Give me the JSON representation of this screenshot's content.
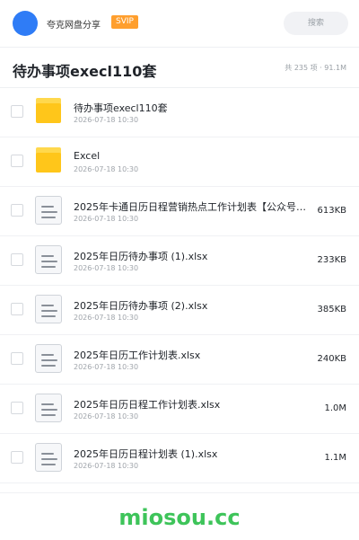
{
  "header": {
    "share_name": "夸克网盘分享",
    "badge": "SVIP",
    "search_label": "搜索"
  },
  "folder": {
    "title": "待办事项execl110套",
    "meta": "共 235 项 · 91.1M"
  },
  "files": [
    {
      "type": "folder",
      "name": "待办事项execl110套",
      "date": "2026-07-18 10:30",
      "size": ""
    },
    {
      "type": "folder",
      "name": "Excel",
      "date": "2026-07-18 10:30",
      "size": ""
    },
    {
      "type": "file",
      "name": "2025年卡通日历日程营销热点工作计划表【公众号：…",
      "date": "2026-07-18 10:30",
      "size": "613KB"
    },
    {
      "type": "file",
      "name": "2025年日历待办事项 (1).xlsx",
      "date": "2026-07-18 10:30",
      "size": "233KB"
    },
    {
      "type": "file",
      "name": "2025年日历待办事项 (2).xlsx",
      "date": "2026-07-18 10:30",
      "size": "385KB"
    },
    {
      "type": "file",
      "name": "2025年日历工作计划表.xlsx",
      "date": "2026-07-18 10:30",
      "size": "240KB"
    },
    {
      "type": "file",
      "name": "2025年日历日程工作计划表.xlsx",
      "date": "2026-07-18 10:30",
      "size": "1.0M"
    },
    {
      "type": "file",
      "name": "2025年日历日程计划表 (1).xlsx",
      "date": "2026-07-18 10:30",
      "size": "1.1M"
    }
  ],
  "watermark": "miosou.cc",
  "colors": {
    "avatar": "#2f7cf6",
    "badge": "#ff9f2e",
    "folder": "#ffc61a",
    "watermark": "#3ec45a"
  }
}
